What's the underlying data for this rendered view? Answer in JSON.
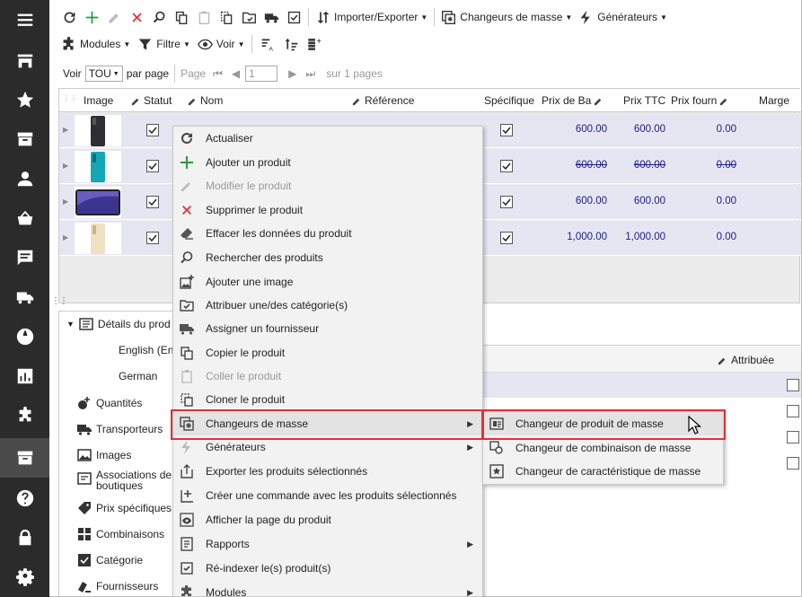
{
  "sidebar": {
    "items": [
      {
        "icon": "menu-icon"
      },
      {
        "icon": "store-icon"
      },
      {
        "icon": "star-icon"
      },
      {
        "icon": "box-icon"
      },
      {
        "icon": "person-icon"
      },
      {
        "icon": "basket-icon"
      },
      {
        "icon": "chat-icon"
      },
      {
        "icon": "truck-icon"
      },
      {
        "icon": "globe-icon"
      },
      {
        "icon": "chart-icon"
      },
      {
        "icon": "puzzle-icon"
      },
      {
        "icon": "catalog-icon"
      },
      {
        "icon": "help-icon"
      },
      {
        "icon": "lock-icon"
      },
      {
        "icon": "gear-icon"
      }
    ],
    "active_index": 11
  },
  "toolbar": {
    "import_export_label": "Importer/Exporter",
    "mass_changers_label": "Changeurs de masse",
    "generators_label": "Générateurs",
    "modules_label": "Modules",
    "filter_label": "Filtre",
    "view_label": "Voir"
  },
  "pager": {
    "show_label": "Voir",
    "show_value": "TOU",
    "per_page_label": "par page",
    "page_label": "Page",
    "page_value": "1",
    "of_pages_label": "sur 1 pages"
  },
  "grid": {
    "columns": {
      "image": "Image",
      "status": "Statut",
      "name": "Nom",
      "reference": "Référence",
      "specific": "Spécifique",
      "base_price": "Prix de Ba",
      "price_ttc": "Prix TTC",
      "supplier_price": "Prix fourn",
      "margin": "Marge"
    },
    "rows": [
      {
        "base_price": "600.00",
        "price_ttc": "600.00",
        "supplier_price": "0.00",
        "strike": false
      },
      {
        "base_price": "600.00",
        "price_ttc": "600.00",
        "supplier_price": "0.00",
        "strike": true
      },
      {
        "base_price": "600.00",
        "price_ttc": "600.00",
        "supplier_price": "0.00",
        "strike": false
      },
      {
        "base_price": "1,000.00",
        "price_ttc": "1,000.00",
        "supplier_price": "0.00",
        "strike": false
      }
    ]
  },
  "details": {
    "title": "Détails du prod",
    "english": "English (Eng",
    "german": "German",
    "items": [
      "Quantités",
      "Transporteurs",
      "Images",
      "Associations de boutiques",
      "Prix spécifiques",
      "Combinaisons",
      "Catégorie",
      "Fournisseurs"
    ],
    "assoc_line1": "Associations de",
    "assoc_line2": "boutiques"
  },
  "right_panel": {
    "attributed_label": "Attribuée"
  },
  "context_menu": {
    "items": [
      {
        "label": "Actualiser",
        "icon": "refresh-icon",
        "disabled": false
      },
      {
        "label": "Ajouter un produit",
        "icon": "plus-icon",
        "disabled": false
      },
      {
        "label": "Modifier le produit",
        "icon": "pencil-icon",
        "disabled": true
      },
      {
        "label": "Supprimer le produit",
        "icon": "close-icon",
        "disabled": false
      },
      {
        "label": "Effacer les données du produit",
        "icon": "eraser-icon",
        "disabled": false
      },
      {
        "label": "Rechercher des produits",
        "icon": "search-icon",
        "disabled": false
      },
      {
        "label": "Ajouter une image",
        "icon": "add-image-icon",
        "disabled": false
      },
      {
        "label": "Attribuer une/des catégorie(s)",
        "icon": "folder-check-icon",
        "disabled": false
      },
      {
        "label": "Assigner un fournisseur",
        "icon": "truck-icon",
        "disabled": false
      },
      {
        "label": "Copier le produit",
        "icon": "copy-icon",
        "disabled": false
      },
      {
        "label": "Coller le produit",
        "icon": "paste-icon",
        "disabled": true
      },
      {
        "label": "Cloner le produit",
        "icon": "clone-icon",
        "disabled": false
      },
      {
        "label": "Changeurs de masse",
        "icon": "mass-change-icon",
        "disabled": false,
        "submenu": true
      },
      {
        "label": "Générateurs",
        "icon": "lightning-icon",
        "disabled": false,
        "submenu": true
      },
      {
        "label": "Exporter les produits sélectionnés",
        "icon": "export-icon",
        "disabled": false
      },
      {
        "label": "Créer une commande avec les produits sélectionnés",
        "icon": "order-add-icon",
        "disabled": false
      },
      {
        "label": "Afficher la page du produit",
        "icon": "eye-icon",
        "disabled": false
      },
      {
        "label": "Rapports",
        "icon": "report-icon",
        "disabled": false,
        "submenu": true
      },
      {
        "label": "Ré-indexer le(s) produit(s)",
        "icon": "reindex-icon",
        "disabled": false
      },
      {
        "label": "Modules",
        "icon": "puzzle-icon",
        "disabled": false,
        "submenu": true
      }
    ]
  },
  "submenu": {
    "items": [
      {
        "label": "Changeur de produit de masse",
        "icon": "product-mass-icon"
      },
      {
        "label": "Changeur de combinaison de masse",
        "icon": "combination-mass-icon"
      },
      {
        "label": "Changeur de caractéristique de masse",
        "icon": "feature-mass-icon"
      }
    ]
  },
  "colors": {
    "sidebar_bg": "#2b2b2b",
    "highlight_border": "#e0303a",
    "price_text": "#1a1a8a",
    "row_bg": "#e6e6f2"
  }
}
